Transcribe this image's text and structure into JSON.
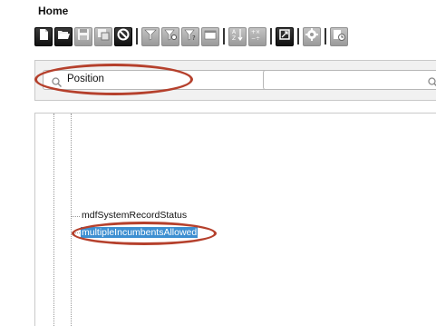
{
  "page": {
    "title": "Home"
  },
  "toolbar": {
    "buttons": [
      {
        "name": "new-icon",
        "style": "dark"
      },
      {
        "name": "open-folder-icon",
        "style": "dark"
      },
      {
        "name": "save-icon",
        "style": "light"
      },
      {
        "name": "save-as-icon",
        "style": "light"
      },
      {
        "name": "cancel-icon",
        "style": "dark"
      },
      {
        "name": "filter-icon",
        "style": "light"
      },
      {
        "name": "filter-settings-icon",
        "style": "light"
      },
      {
        "name": "filter-help-icon",
        "style": "light"
      },
      {
        "name": "date-filter-icon",
        "style": "light"
      },
      {
        "name": "sort-icon",
        "style": "light"
      },
      {
        "name": "calculate-icon",
        "style": "light"
      },
      {
        "name": "refresh-icon",
        "style": "dark"
      },
      {
        "name": "settings-icon",
        "style": "light"
      },
      {
        "name": "schedule-icon",
        "style": "light"
      }
    ]
  },
  "filter": {
    "combo_value": "Position",
    "search_value": ""
  },
  "tree": {
    "items": [
      {
        "label": "mdfSystemRecordStatus",
        "selected": false
      },
      {
        "label": "multipleIncumbentsAllowed",
        "selected": true
      }
    ]
  },
  "colors": {
    "selection": "#3d8fd1",
    "highlight_ring": "#b5402c",
    "dropdown_arrow": "#2563a8"
  }
}
